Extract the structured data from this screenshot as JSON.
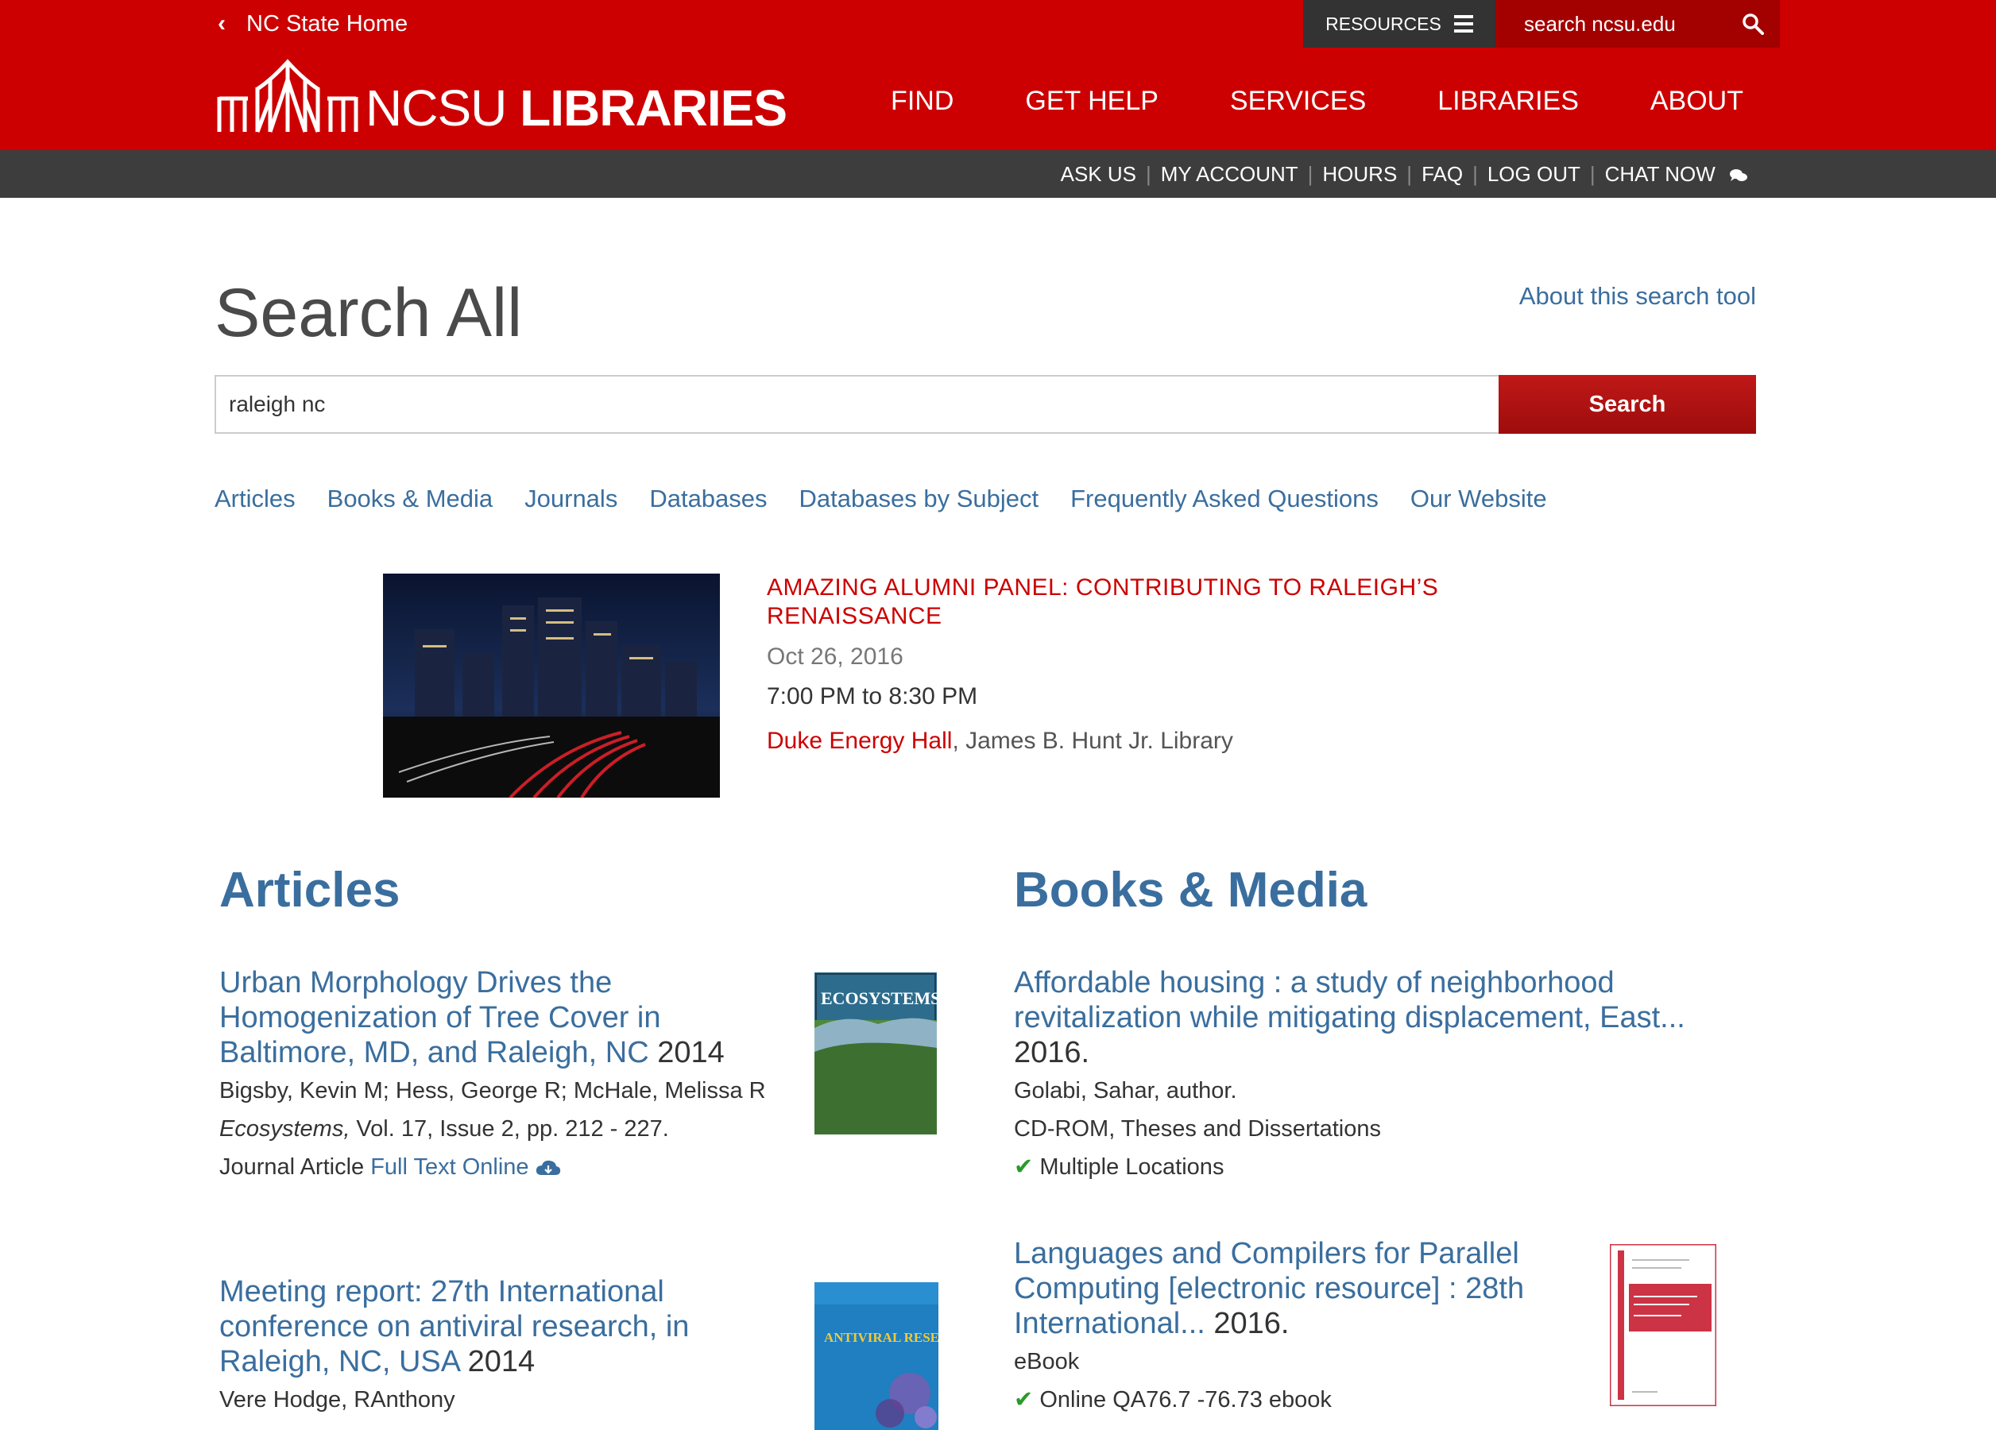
{
  "header": {
    "home_link": "NC State Home",
    "resources": "RESOURCES",
    "search_placeholder": "search ncsu.edu",
    "logo_light": "NCSU",
    "logo_bold": "LIBRARIES",
    "nav": [
      "FIND",
      "GET HELP",
      "SERVICES",
      "LIBRARIES",
      "ABOUT"
    ],
    "sub_links": [
      "ASK US",
      "MY ACCOUNT",
      "HOURS",
      "FAQ",
      "LOG OUT",
      "CHAT NOW"
    ]
  },
  "page": {
    "title": "Search All",
    "about_link": "About this search tool",
    "query": "raleigh nc",
    "search_button": "Search",
    "tabs": [
      "Articles",
      "Books & Media",
      "Journals",
      "Databases",
      "Databases by Subject",
      "Frequently Asked Questions",
      "Our Website"
    ]
  },
  "event": {
    "title": "AMAZING ALUMNI PANEL: CONTRIBUTING TO RALEIGH’S RENAISSANCE",
    "date": "Oct 26, 2016",
    "time": "7:00 PM to 8:30 PM",
    "room": "Duke Energy Hall",
    "building": ", James B. Hunt Jr. Library"
  },
  "articles": {
    "heading": "Articles",
    "items": [
      {
        "title": "Urban Morphology Drives the Homogenization of Tree Cover in Baltimore, MD, and Raleigh, NC",
        "year": "2014",
        "authors": "Bigsby, Kevin M; Hess, George R; McHale, Melissa R",
        "journal": "Ecosystems,",
        "citation": " Vol. 17, Issue 2, pp. 212 - 227.",
        "type": "Journal Article",
        "link": "Full Text Online",
        "cover_text": "ECOSYSTEMS"
      },
      {
        "title": "Meeting report: 27th International conference on antiviral research, in Raleigh, NC, USA",
        "year": "2014",
        "authors": "Vere Hodge, RAnthony",
        "cover_text": "ANTIVIRAL RESEARCH"
      }
    ]
  },
  "books": {
    "heading": "Books & Media",
    "items": [
      {
        "title": "Affordable housing : a study of neighborhood revitalization while mitigating displacement, East...",
        "year": "2016.",
        "author": "Golabi, Sahar, author.",
        "format": "CD-ROM, Theses and Dissertations",
        "availability": "Multiple Locations"
      },
      {
        "title": "Languages and Compilers for Parallel Computing [electronic resource] : 28th International...",
        "year": "2016.",
        "format": "eBook",
        "availability": "Online QA76.7 -76.73 ebook"
      }
    ]
  },
  "colors": {
    "brand_red": "#cc0000",
    "link_blue": "#3a6e9e",
    "subbar": "#3d3d3d"
  }
}
